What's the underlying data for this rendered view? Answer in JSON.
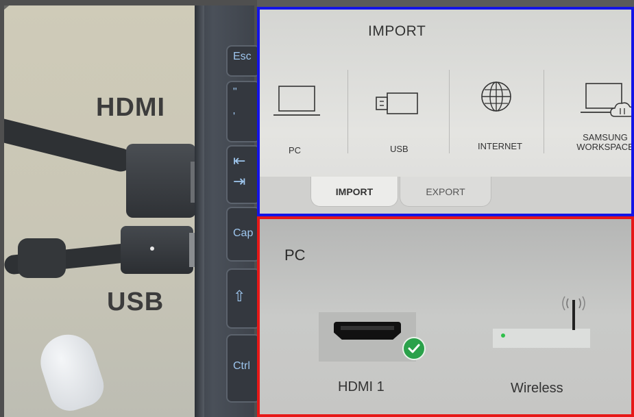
{
  "photo": {
    "hdmi_label": "HDMI",
    "usb_label": "USB",
    "keys": [
      "Esc",
      "\"",
      "'",
      "⇤",
      "⇥",
      "Cap",
      "⇧",
      "Ctrl"
    ]
  },
  "import_panel": {
    "title": "IMPORT",
    "sources": [
      {
        "label": "PC",
        "icon": "laptop-icon"
      },
      {
        "label": "USB",
        "icon": "usb-drive-icon"
      },
      {
        "label": "INTERNET",
        "icon": "globe-icon"
      },
      {
        "label": "SAMSUNG WORKSPACE",
        "icon": "cloud-laptop-icon"
      }
    ],
    "tabs": [
      {
        "label": "IMPORT",
        "active": true
      },
      {
        "label": "EXPORT",
        "active": false
      }
    ]
  },
  "pc_panel": {
    "title": "PC",
    "inputs": [
      {
        "label": "HDMI 1",
        "icon": "hdmi-port-icon",
        "status": "connected"
      },
      {
        "label": "Wireless",
        "icon": "wireless-router-icon",
        "status": "available"
      }
    ]
  },
  "colors": {
    "import_border": "#1414e6",
    "pc_border": "#e61818",
    "check_green": "#2aa14a"
  }
}
